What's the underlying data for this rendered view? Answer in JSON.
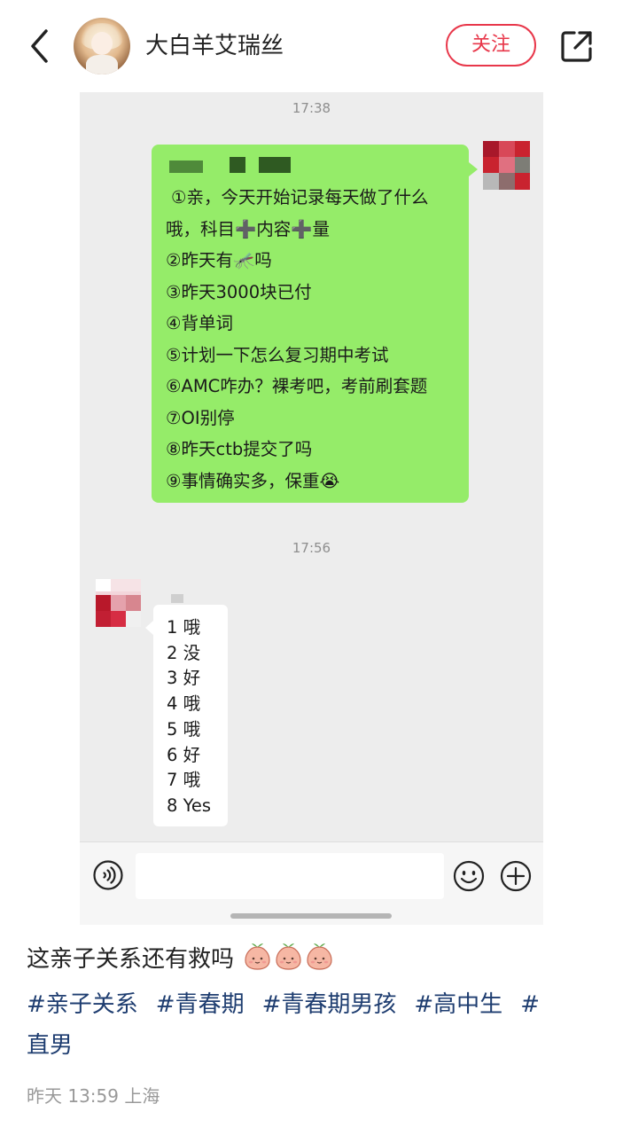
{
  "header": {
    "back_icon": "back-chevron-icon",
    "username": "大白羊艾瑞丝",
    "follow_label": "关注",
    "share_icon": "share-icon"
  },
  "chat": {
    "timestamp_1": "17:38",
    "sent_message": {
      "lines": [
        "①亲，今天开始记录每天做了什么",
        "哦，科目➕内容➕量",
        "②昨天有🦟吗",
        "③昨天3000块已付",
        "④背单词",
        "⑤计划一下怎么复习期中考试",
        "⑥AMC咋办？裸考吧，考前刷套题",
        "⑦OI别停",
        "⑧昨天ctb提交了吗",
        "⑨事情确实多，保重😭"
      ]
    },
    "timestamp_2": "17:56",
    "reply_message": {
      "lines": [
        "1 哦",
        "2 没",
        "3 好",
        "4 哦",
        "5 哦",
        "6 好",
        "7 哦",
        "8 Yes"
      ]
    },
    "input_bar": {
      "voice_icon": "voice-icon",
      "emoji_icon": "emoji-icon",
      "plus_icon": "plus-icon"
    }
  },
  "post": {
    "caption": "这亲子关系还有救吗",
    "caption_emoji_icon": "peach-emoji-icon",
    "tags": [
      "#亲子关系",
      "#青春期",
      "#青春期男孩",
      "#高中生",
      "#",
      "直男"
    ],
    "meta": "昨天 13:59 上海"
  },
  "colors": {
    "accent": "#e8374a",
    "bubble_green": "#95ec69",
    "tag_blue": "#1e3d70",
    "chat_bg": "#ededed"
  }
}
